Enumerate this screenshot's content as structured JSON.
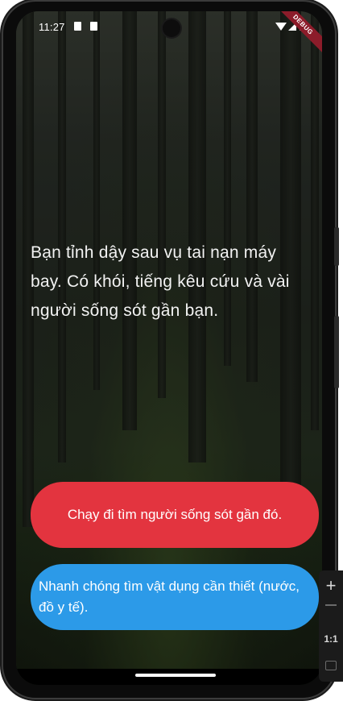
{
  "status_bar": {
    "time": "11:27",
    "debug_label": "DEBUG"
  },
  "story": {
    "text": "Bạn tỉnh dậy sau vụ tai nạn máy bay. Có khói, tiếng kêu cứu và vài người sống sót gần bạn."
  },
  "choices": [
    {
      "label": "Chạy đi tìm người sống sót gần đó.",
      "color": "#e3343f"
    },
    {
      "label": "Nhanh chóng tìm vật dụng cần thiết (nước, đồ y tế).",
      "color": "#2c9ae8"
    }
  ],
  "emulator_toolbar": {
    "zoom_in_icon": "plus-icon",
    "zoom_out_icon": "minus-icon",
    "ratio_label": "1:1",
    "fit_icon": "fit-screen-icon"
  },
  "colors": {
    "background": "#1c2418",
    "text": "#f2f2f2",
    "debug_banner": "#8c1c2a"
  }
}
